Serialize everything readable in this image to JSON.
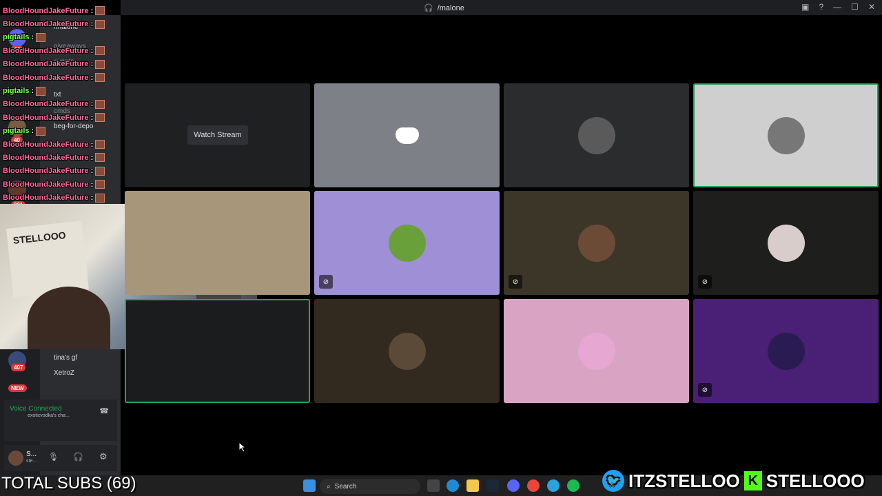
{
  "window": {
    "title": "/malone"
  },
  "chat_overlay": {
    "messages": [
      {
        "user": "BloodHoundJakeFuture",
        "color": "#ff6b9a"
      },
      {
        "user": "BloodHoundJakeFuture",
        "color": "#ff6b9a"
      },
      {
        "user": "pigtails",
        "color": "#7cff4f"
      },
      {
        "user": "BloodHoundJakeFuture",
        "color": "#ff6b9a"
      },
      {
        "user": "BloodHoundJakeFuture",
        "color": "#ff6b9a"
      },
      {
        "user": "BloodHoundJakeFuture",
        "color": "#ff6b9a"
      },
      {
        "user": "pigtails",
        "color": "#7cff4f"
      },
      {
        "user": "BloodHoundJakeFuture",
        "color": "#ff6b9a"
      },
      {
        "user": "BloodHoundJakeFuture",
        "color": "#ff6b9a"
      },
      {
        "user": "pigtails",
        "color": "#7cff4f"
      },
      {
        "user": "BloodHoundJakeFuture",
        "color": "#ff6b9a"
      },
      {
        "user": "BloodHoundJakeFuture",
        "color": "#ff6b9a"
      },
      {
        "user": "BloodHoundJakeFuture",
        "color": "#ff6b9a"
      },
      {
        "user": "BloodHoundJakeFuture",
        "color": "#ff6b9a"
      },
      {
        "user": "BloodHoundJakeFuture",
        "color": "#ff6b9a"
      }
    ],
    "separator": ":"
  },
  "channels": [
    {
      "name": "/malone"
    },
    {
      "name": "giveaways"
    },
    {
      "name": "events"
    },
    {
      "name": "txt"
    },
    {
      "name": "cmds"
    },
    {
      "name": "beg-for-depo"
    }
  ],
  "server_badges": [
    "44",
    "40",
    "201",
    "407",
    "NEW"
  ],
  "voice_members": [
    {
      "name": "tina's gf"
    },
    {
      "name": "XetroZ"
    }
  ],
  "voice_status": {
    "label": "Voice Connected",
    "channel": "exoticvodka's cha..."
  },
  "grid": {
    "watch_label": "Watch Stream",
    "tiles": [
      {
        "bg": "#1e2022",
        "kind": "watch",
        "muted": false
      },
      {
        "bg": "#7d8087",
        "kind": "discord",
        "muted": false
      },
      {
        "bg": "#2b2c2e",
        "kind": "avatar",
        "avatar": "#5a5a5a",
        "muted": false
      },
      {
        "bg": "#cfcfcf",
        "kind": "avatar",
        "avatar": "#777777",
        "muted": false,
        "speaking": true
      },
      {
        "bg": "#a8967a",
        "kind": "empty",
        "muted": false
      },
      {
        "bg": "#9f8fd6",
        "kind": "avatar",
        "avatar": "#6aa03a",
        "muted": true
      },
      {
        "bg": "#3c3629",
        "kind": "avatar",
        "avatar": "#6b4a36",
        "muted": true
      },
      {
        "bg": "#1e1e1c",
        "kind": "avatar",
        "avatar": "#d8cdca",
        "muted": true
      },
      {
        "bg": "#1a1c1d",
        "kind": "empty",
        "muted": false,
        "speaking": true
      },
      {
        "bg": "#322a1e",
        "kind": "avatar",
        "avatar": "#5b4a38",
        "muted": false
      },
      {
        "bg": "#d9a3c4",
        "kind": "avatar",
        "avatar": "#e6a8d2",
        "muted": false
      },
      {
        "bg": "#4a1f76",
        "kind": "avatar",
        "avatar": "#2a1c52",
        "muted": true
      }
    ]
  },
  "taskbar": {
    "search_placeholder": "Search"
  },
  "overlay_text": {
    "subs": "TOTAL SUBS (69)",
    "twitter_handle": "ITZSTELLOO",
    "kick_handle": "STELLOOO"
  },
  "webcam": {
    "banner_text": "STELLOOO"
  },
  "user_panel": {
    "username": "S...",
    "status": "ste..."
  }
}
